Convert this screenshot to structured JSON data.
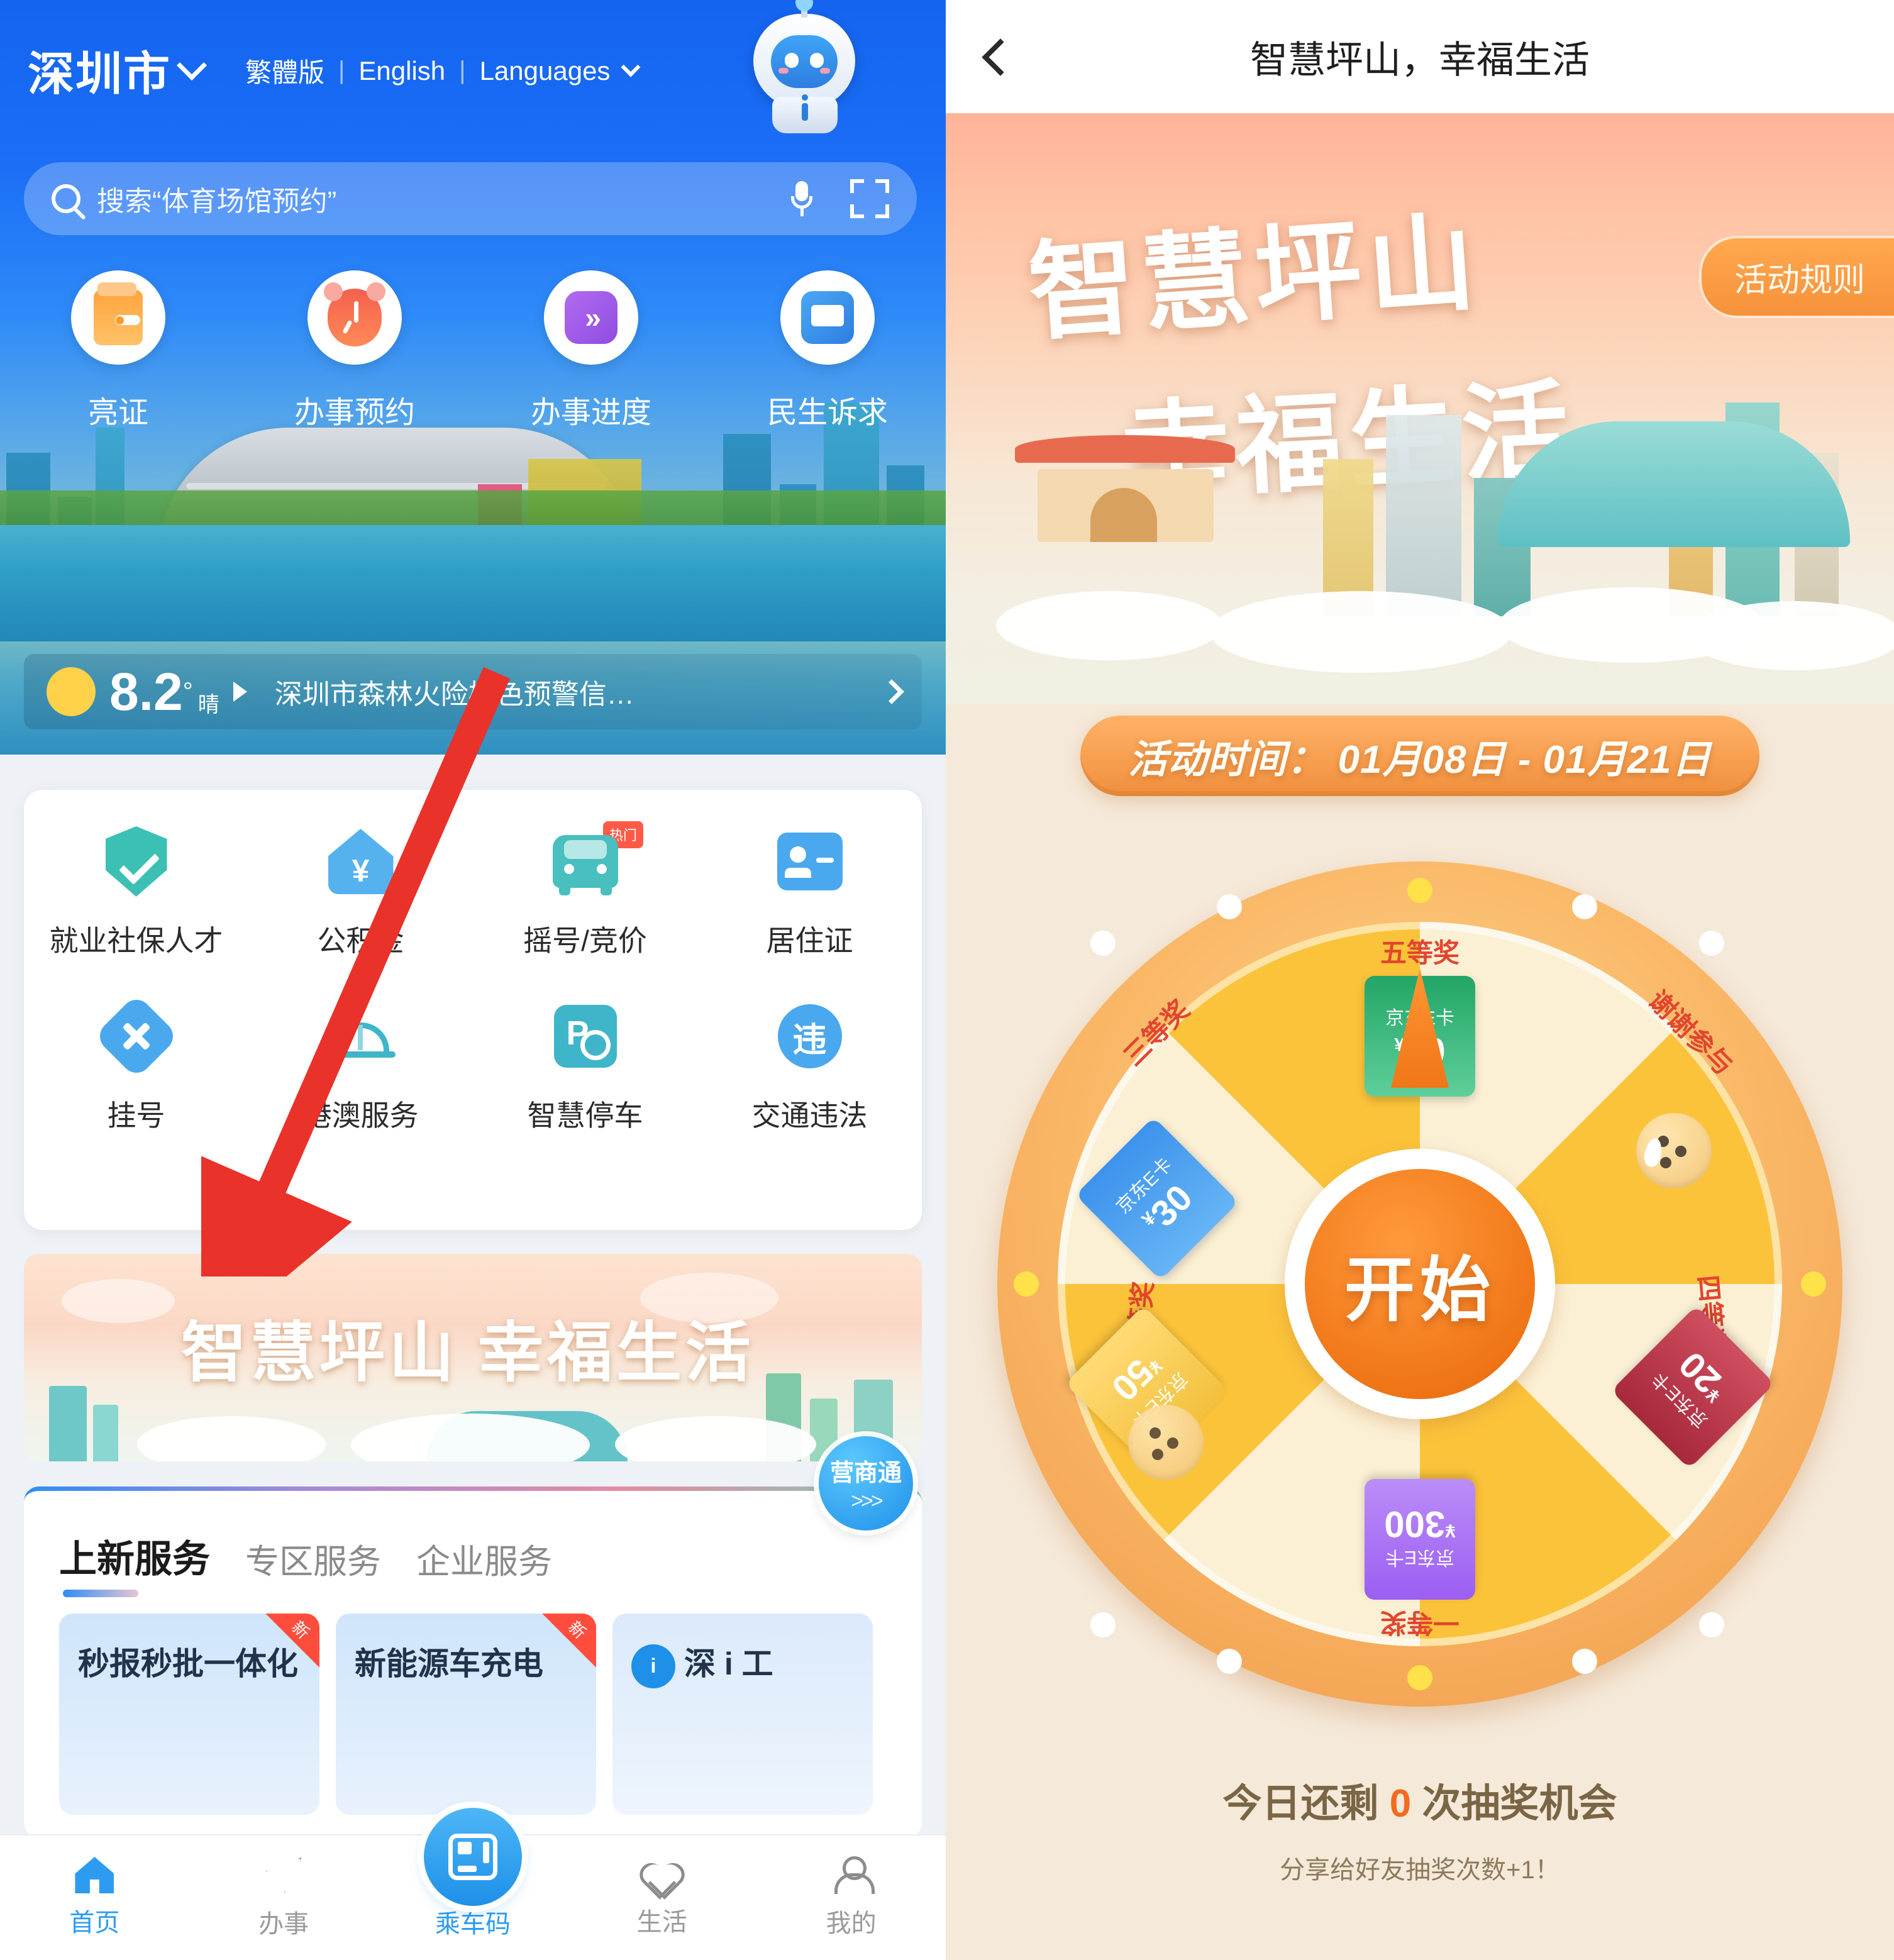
{
  "left": {
    "header": {
      "city": "深圳市",
      "chevron_icon": "chevron-down-icon",
      "lang_traditional": "繁體版",
      "separator1": "|",
      "lang_english": "English",
      "separator2": "|",
      "lang_more": "Languages",
      "lang_chevron_icon": "chevron-down-icon",
      "assistant_icon": "robot-assistant-icon"
    },
    "search": {
      "icon": "search-icon",
      "placeholder": "搜索“体育场馆预约”",
      "mic_icon": "microphone-icon",
      "scan_icon": "scan-qr-icon"
    },
    "quick_entries": [
      {
        "label": "亮证",
        "icon": "wallet-icon"
      },
      {
        "label": "办事预约",
        "icon": "alarm-clock-icon"
      },
      {
        "label": "办事进度",
        "icon": "double-chevron-icon"
      },
      {
        "label": "民生诉求",
        "icon": "book-icon"
      }
    ],
    "weather": {
      "sun_icon": "sun-icon",
      "temperature": "8.2",
      "degree": "°",
      "condition": "晴",
      "play_icon": "triangle-right-icon",
      "news": "深圳市森林火险橙色预警信…",
      "arrow_icon": "chevron-right-icon"
    },
    "services": [
      {
        "label": "就业社保人才",
        "icon": "shield-check-icon",
        "badge": ""
      },
      {
        "label": "公积金",
        "icon": "house-yuan-icon",
        "badge": ""
      },
      {
        "label": "摇号/竞价",
        "icon": "car-icon",
        "badge": "热门"
      },
      {
        "label": "居住证",
        "icon": "id-card-icon",
        "badge": ""
      },
      {
        "label": "挂号",
        "icon": "medical-plus-icon",
        "badge": ""
      },
      {
        "label": "港澳服务",
        "icon": "bridge-icon",
        "badge": ""
      },
      {
        "label": "智慧停车",
        "icon": "parking-icon",
        "badge": ""
      },
      {
        "label": "交通违法",
        "icon": "violation-icon",
        "badge": ""
      }
    ],
    "promo_banner": {
      "text": "智慧坪山 幸福生活"
    },
    "floating_button": {
      "label": "营商通",
      "arrows_icon": "double-chevron-right-icon"
    },
    "tabs": [
      {
        "label": "上新服务",
        "active": true
      },
      {
        "label": "专区服务",
        "active": false
      },
      {
        "label": "企业服务",
        "active": false
      }
    ],
    "service_cards": [
      {
        "title": "秒报秒批一体化",
        "badge": "新"
      },
      {
        "title": "新能源车充电",
        "badge": "新"
      },
      {
        "title": "深 i 工",
        "badge": "",
        "logo": "深i工"
      }
    ],
    "bottom_nav": [
      {
        "label": "首页",
        "icon": "home-icon",
        "active": true
      },
      {
        "label": "办事",
        "icon": "navigation-arrow-icon",
        "active": false
      },
      {
        "label": "乘车码",
        "icon": "bus-qr-icon",
        "active": true,
        "center": true
      },
      {
        "label": "生活",
        "icon": "heart-icon",
        "active": false
      },
      {
        "label": "我的",
        "icon": "user-icon",
        "active": false
      }
    ],
    "annotation": {
      "type": "red-arrow",
      "color": "#e8322a"
    }
  },
  "right": {
    "header": {
      "back_icon": "back-chevron-icon",
      "title": "智慧坪山，幸福生活"
    },
    "banner": {
      "line1": "智慧坪山",
      "line2": "幸福生活",
      "rules_button": "活动规则"
    },
    "activity_time": {
      "label": "活动时间：",
      "range": "01月08日 - 01月21日",
      "full": "活动时间： 01月08日 - 01月21日"
    },
    "wheel": {
      "start_button": "开始",
      "pointer_icon": "wheel-pointer-icon",
      "segments": [
        {
          "tier": "五等奖",
          "prize_name": "京东E卡",
          "amount": "10",
          "currency": "¥",
          "color": "#2fb87a",
          "angle": 0
        },
        {
          "tier": "谢谢参与",
          "prize_name": "",
          "amount": "",
          "currency": "",
          "color": "#f3c678",
          "angle": 45
        },
        {
          "tier": "四等奖",
          "prize_name": "京东E卡",
          "amount": "20",
          "currency": "¥",
          "color": "#b8384a",
          "angle": 90
        },
        {
          "tier": "一等奖",
          "prize_name": "京东E卡",
          "amount": "300",
          "currency": "¥",
          "color": "#9b6cf0",
          "angle": 135
        },
        {
          "tier": "二等奖",
          "prize_name": "京东E卡",
          "amount": "50",
          "currency": "¥",
          "color": "#f5c542",
          "angle": 180
        },
        {
          "tier": "谢谢参与",
          "prize_name": "",
          "amount": "",
          "currency": "",
          "color": "#f3c678",
          "angle": 225
        },
        {
          "tier": "三等奖",
          "prize_name": "京东E卡",
          "amount": "30",
          "currency": "¥",
          "color": "#4a9cf0",
          "angle": 270
        }
      ]
    },
    "footer": {
      "remaining_prefix": "今日还剩 ",
      "remaining_count": "0",
      "remaining_suffix": " 次抽奖机会",
      "share_hint": "分享给好友抽奖次数+1！"
    }
  },
  "colors": {
    "brand_blue": "#1e90e8",
    "accent_orange": "#f07617",
    "badge_red": "#ff4d3d",
    "wheel_gold": "#fbc33a"
  }
}
